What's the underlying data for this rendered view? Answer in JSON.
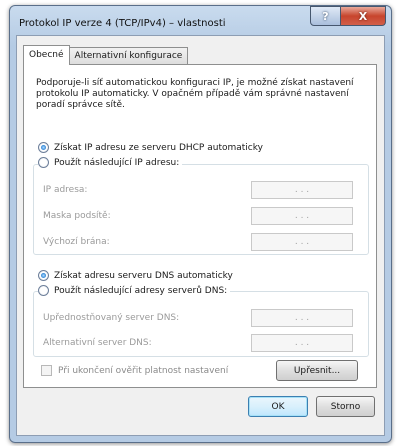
{
  "window": {
    "title": "Protokol IP verze 4 (TCP/IPv4) – vlastnosti",
    "help_label": "?",
    "close_label": "X"
  },
  "tabs": [
    {
      "label": "Obecné",
      "active": true
    },
    {
      "label": "Alternativní konfigurace",
      "active": false
    }
  ],
  "general": {
    "description": "Podporuje-li síť automatickou konfiguraci IP, je možné získat nastavení protokolu IP automaticky. V opačném případě vám správné nastavení poradí správce sítě.",
    "ip_auto_label": "Získat IP adresu ze serveru DHCP automaticky",
    "ip_manual_label": "Použít následující IP adresu:",
    "ip_fields": [
      {
        "label": "IP adresa:",
        "value": ". . ."
      },
      {
        "label": "Maska podsítě:",
        "value": ". . ."
      },
      {
        "label": "Výchozí brána:",
        "value": ". . ."
      }
    ],
    "dns_auto_label": "Získat adresu serveru DNS automaticky",
    "dns_manual_label": "Použít následující adresy serverů DNS:",
    "dns_fields": [
      {
        "label": "Upřednostňovaný server DNS:",
        "value": ". . ."
      },
      {
        "label": "Alternativní server DNS:",
        "value": ". . ."
      }
    ],
    "validate_label": "Při ukončení ověřit platnost nastavení",
    "advanced_label": "Upřesnit..."
  },
  "footer": {
    "ok_label": "OK",
    "cancel_label": "Storno"
  }
}
